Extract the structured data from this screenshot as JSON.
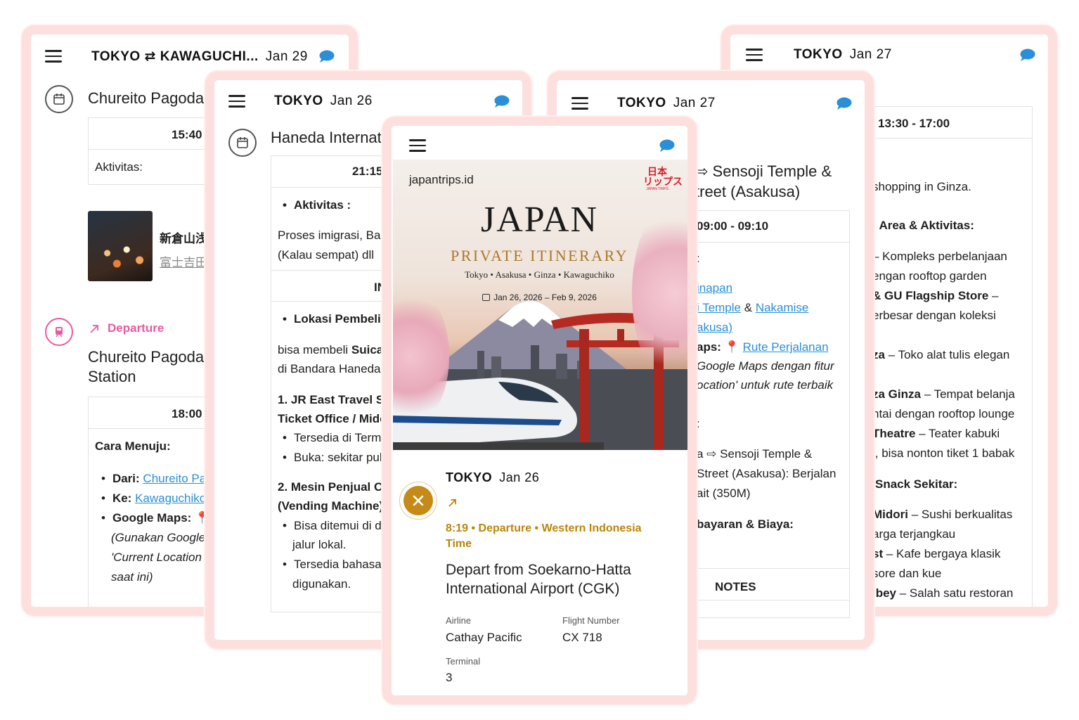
{
  "colors": {
    "card_border": "#fde0de",
    "bubble": "#2a8fd6",
    "link": "#2a8fd6",
    "pink_accent": "#e85aa2",
    "gold_accent": "#b8860b",
    "flight_badge": "#c58a17"
  },
  "icons": {
    "menu": "hamburger-icon",
    "chat": "chat-bubble-icon",
    "calendar": "calendar-icon",
    "train": "train-icon",
    "plane": "plane-icon",
    "arrow": "arrow-up-right-icon",
    "pin": "map-pin-icon"
  },
  "card1": {
    "title": "TOKYO ⇄ KAWAGUCHI...",
    "date": "Jan 29",
    "place1": "Chureito Pagoda",
    "time1": "15:40",
    "activity_label": "Aktivitas:",
    "photo_title": "新倉山浅",
    "photo_link": "富士吉田",
    "departure_label": "Departure",
    "place2_line1": "Chureito Pagoda",
    "place2_line2": "Station",
    "time2": "18:00",
    "cara_label": "Cara Menuju:",
    "dari_label": "Dari:",
    "dari_link": "Chureito Pa",
    "ke_label": "Ke:",
    "ke_link": "Kawaguchiko",
    "maps_label": "Google Maps:",
    "maps_note_1": "(Gunakan Google",
    "maps_note_2": "'Current Location",
    "maps_note_3": "saat ini)"
  },
  "card2": {
    "title": "TOKYO",
    "date": "Jan 26",
    "place": "Haneda Internati",
    "time": "21:15",
    "aktivitas_label": "Aktivitas :",
    "aktivitas_text_1": "Proses imigrasi, Bag",
    "aktivitas_text_2": "(Kalau sempat) dll",
    "section_label": "IN",
    "lokasi_label": "Lokasi Pembeli",
    "beli_text_1a": "bisa membeli ",
    "beli_text_1b": "Suica",
    "beli_text_2": "di Bandara Haneda",
    "jr_1": "1. JR East Travel Se",
    "jr_2": "Ticket Office / Midc",
    "jr_b1": "Tersedia di Term",
    "jr_b2": "Buka: sekitar pul",
    "mesin_1": "2. Mesin Penjual O",
    "mesin_2": "(Vending Machine)",
    "mesin_b1": "Bisa ditemui di d",
    "mesin_b1b": "jalur lokal.",
    "mesin_b2": "Tersedia bahasa",
    "mesin_b2b": "digunakan."
  },
  "card3": {
    "title": "TOKYO",
    "date": "Jan 27",
    "heading_1": "⇨ Sensoji Temple &",
    "heading_2": "treet (Asakusa)",
    "time": "09:00 - 09:10",
    "colon": ":",
    "link_inapan": "inapan",
    "link_temple": "i Temple",
    "amp": "&",
    "link_nakamise": "Nakamise",
    "link_akusa": "akusa)",
    "maps_label": "aps:",
    "maps_link": "Rute Perjalanan",
    "maps_note_1": "Google Maps dengan fitur",
    "maps_note_2": "ocation' untuk rute terbaik",
    "colon2": ":",
    "route_1": "a ⇨ Sensoji Temple &",
    "route_2": "Street (Asakusa): Berjalan",
    "route_3": "ait (350M)",
    "biaya_label": "bayaran & Biaya:",
    "notes_label": "NOTES"
  },
  "card4": {
    "title": "TOKYO",
    "date": "Jan 27",
    "time": "13:30 - 17:00",
    "shopping": "shopping in Ginza.",
    "area_label": "Area & Aktivitas:",
    "l1": "– Kompleks perbelanjaan",
    "l2": "engan rooftop garden",
    "l3a": "& GU Flagship Store",
    "l3b": " –",
    "l4": "erbesar dengan koleksi",
    "l5a": "za",
    "l5b": " – Toko alat tulis elegan",
    "l6a": "za Ginza",
    "l6b": " – Tempat belanja",
    "l7": "ntai dengan rooftop lounge",
    "l8a": "Theatre",
    "l8b": " – Teater kabuki",
    "l9": "l, bisa nonton tiket 1 babak",
    "snack_label": "Snack Sekitar:",
    "s1a": "Midori",
    "s1b": " – Sushi berkualitas",
    "s2": "arga terjangkau",
    "s3a": "st",
    "s3b": " – Kafe bergaya klasik",
    "s4": "sore dan kue",
    "s5a": "ibey",
    "s5b": " – Salah satu restoran"
  },
  "front": {
    "brand": "japantrips.id",
    "logo_text": "日本\nリップス",
    "logo_small": "JAPAN TRIPS",
    "cover_title": "JAPAN",
    "cover_subtitle": "PRIVATE ITINERARY",
    "cities": "Tokyo • Asakusa • Ginza • Kawaguchiko",
    "dates": "Jan 26, 2026 – Feb 9, 2026",
    "day_title": "TOKYO",
    "day_date": "Jan 26",
    "time_line_1": "8:19 • Departure • Western Indonesia",
    "time_line_2": "Time",
    "depart_1": "Depart from Soekarno-Hatta",
    "depart_2": "International Airport (CGK)",
    "airline_label": "Airline",
    "airline": "Cathay Pacific",
    "flight_label": "Flight Number",
    "flight": "CX 718",
    "terminal_label": "Terminal",
    "terminal": "3"
  }
}
